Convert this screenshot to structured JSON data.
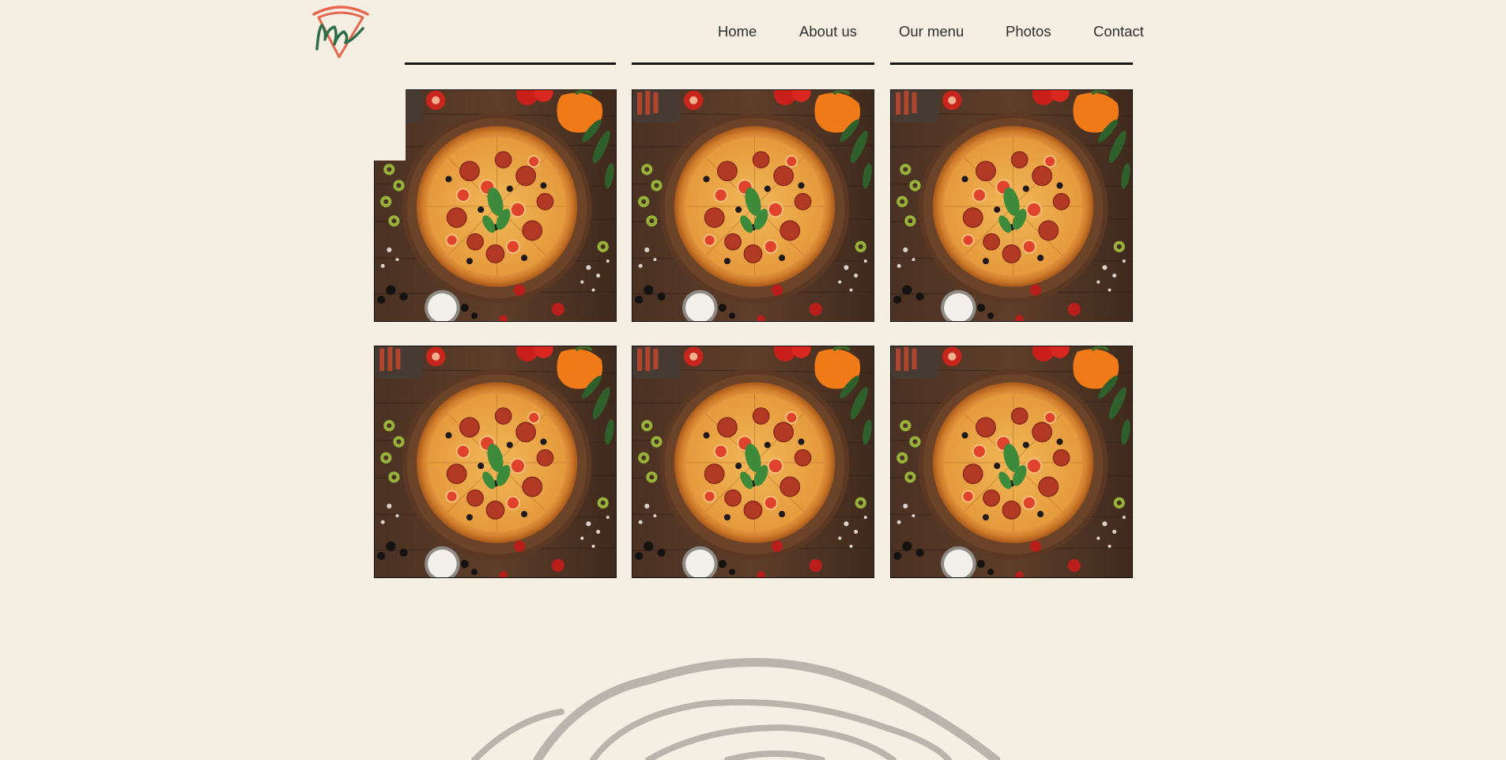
{
  "brand": {
    "logo": "pizza-slice-m-logo"
  },
  "nav": {
    "items": [
      {
        "label": "Home"
      },
      {
        "label": "About us"
      },
      {
        "label": "Our menu"
      },
      {
        "label": "Photos"
      },
      {
        "label": "Contact"
      }
    ]
  },
  "gallery": {
    "rows": 2,
    "columns": 3,
    "photos": [
      {
        "subject": "pizza-photo"
      },
      {
        "subject": "pizza-photo"
      },
      {
        "subject": "pizza-photo"
      },
      {
        "subject": "pizza-photo"
      },
      {
        "subject": "pizza-photo"
      },
      {
        "subject": "pizza-photo"
      }
    ]
  },
  "colors": {
    "background": "#f5efe3",
    "logo_red": "#e8664c",
    "logo_green": "#2f6e4a",
    "text": "#2f2f2f"
  }
}
